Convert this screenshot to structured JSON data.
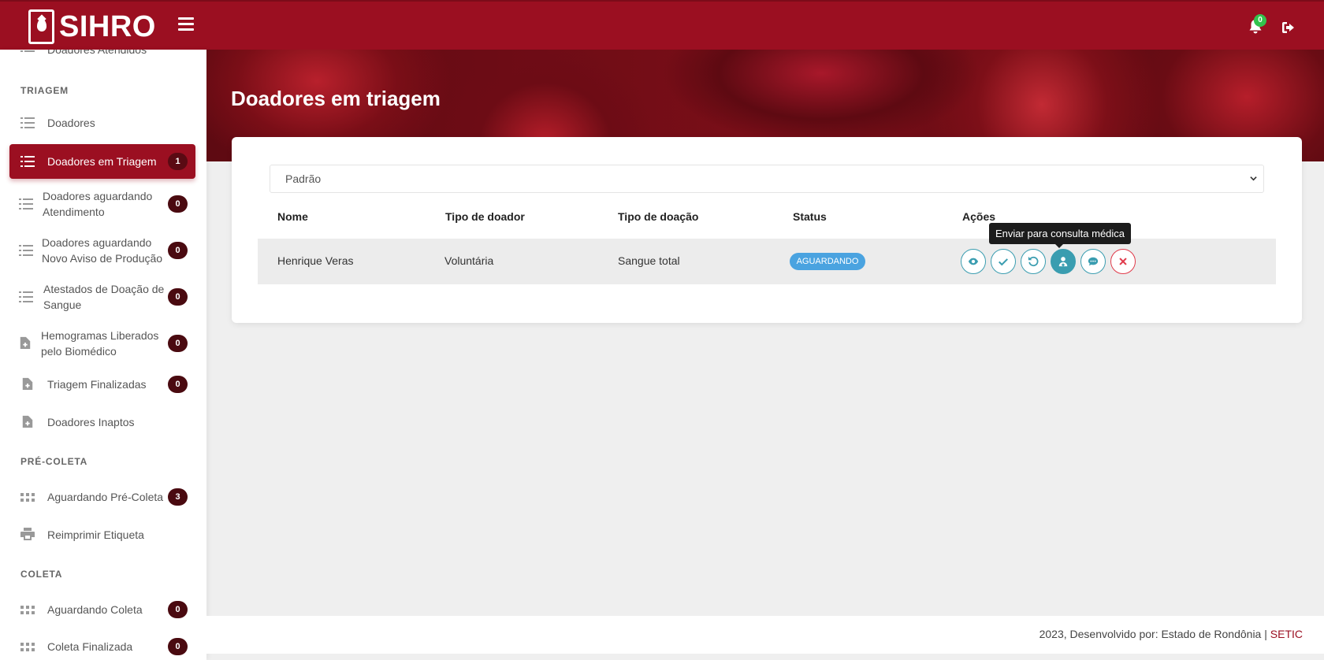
{
  "app": {
    "logo_text": "SIHRO"
  },
  "header": {
    "notifications_count": "0"
  },
  "sidebar": {
    "partial_item_label": "Doadores Atendidos",
    "sections": [
      "TRIAGEM",
      "PRÉ-COLETA",
      "COLETA"
    ],
    "items": [
      {
        "label": "Doadores",
        "badge": null
      },
      {
        "label": "Doadores em Triagem",
        "badge": "1"
      },
      {
        "label_line1": "Doadores aguardando",
        "label_line2": "Atendimento",
        "badge": "0"
      },
      {
        "label_line1": "Doadores aguardando",
        "label_line2": "Novo Aviso de Produção",
        "badge": "0"
      },
      {
        "label_line1": "Atestados de Doação de",
        "label_line2": "Sangue",
        "badge": "0"
      },
      {
        "label_line1": "Hemogramas Liberados",
        "label_line2": "pelo Biomédico",
        "badge": "0"
      },
      {
        "label": "Triagem Finalizadas",
        "badge": "0"
      },
      {
        "label": "Doadores Inaptos",
        "badge": null
      },
      {
        "label": "Aguardando Pré-Coleta",
        "badge": "3"
      },
      {
        "label": "Reimprimir Etiqueta",
        "badge": null
      },
      {
        "label": "Aguardando Coleta",
        "badge": "0"
      },
      {
        "label": "Coleta Finalizada",
        "badge": "0"
      }
    ]
  },
  "main": {
    "title": "Doadores em triagem",
    "filter": {
      "selected": "Padrão"
    },
    "table": {
      "headers": [
        "Nome",
        "Tipo de doador",
        "Tipo de doação",
        "Status",
        "Ações"
      ],
      "rows": [
        {
          "nome": "Henrique Veras",
          "tipo_doador": "Voluntária",
          "tipo_doacao": "Sangue total",
          "status": "AGUARDANDO"
        }
      ]
    },
    "tooltip": "Enviar para consulta médica"
  },
  "footer": {
    "text": "2023, Desenvolvido por: Estado de Rondônia | ",
    "link": "SETIC"
  },
  "colors": {
    "primary": "#9b0f21",
    "badge": "#4a0a10",
    "action": "#3a9db0",
    "status": "#4aa3e0",
    "danger": "#e03a4a"
  }
}
